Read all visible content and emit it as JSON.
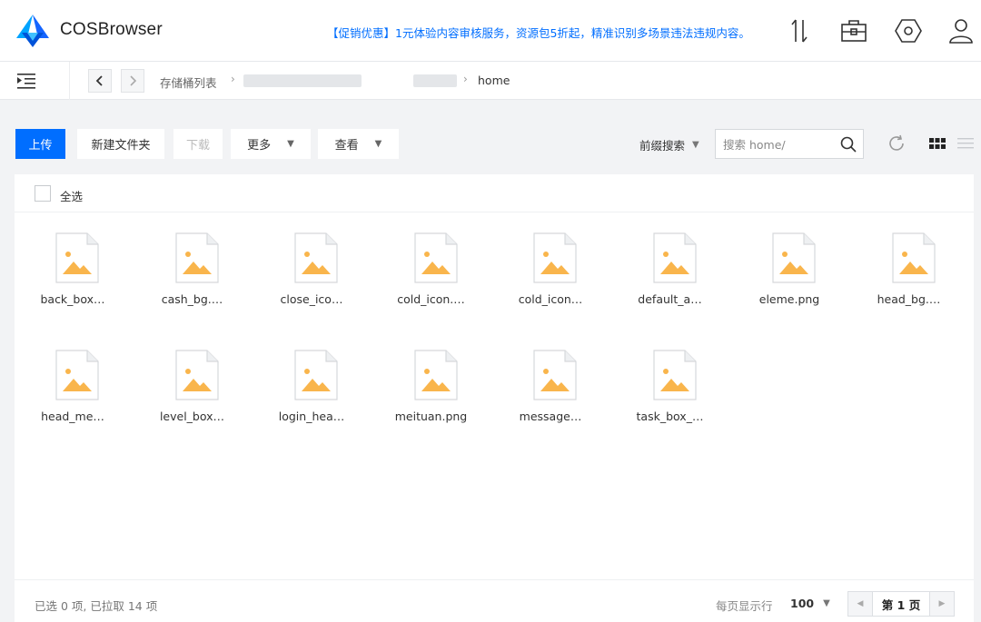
{
  "header": {
    "app_title": "COSBrowser",
    "promo": "【促销优惠】1元体验内容审核服务，资源包5折起，精准识别多场景违法违规内容。",
    "icons": [
      "transfer-icon",
      "toolbox-icon",
      "settings-icon",
      "user-icon"
    ]
  },
  "breadcrumb": {
    "root": "存储桶列表",
    "current": "home"
  },
  "toolbar": {
    "upload": "上传",
    "new_folder": "新建文件夹",
    "download": "下载",
    "more": "更多",
    "view": "查看",
    "prefix_search": "前缀搜索",
    "search_placeholder": "搜索 home/"
  },
  "content": {
    "select_all": "全选",
    "files": [
      "back_box…",
      "cash_bg.…",
      "close_ico…",
      "cold_icon.…",
      "cold_icon…",
      "default_a…",
      "eleme.png",
      "head_bg.…",
      "head_me…",
      "level_box…",
      "login_hea…",
      "meituan.png",
      "message…",
      "task_box_…"
    ]
  },
  "footer": {
    "status": "已选 0 项, 已拉取 14 项",
    "per_page_label": "每页显示行",
    "per_page_value": "100",
    "page": "第 1 页"
  },
  "colors": {
    "accent": "#006eff",
    "image_icon": "#f9b54c"
  }
}
